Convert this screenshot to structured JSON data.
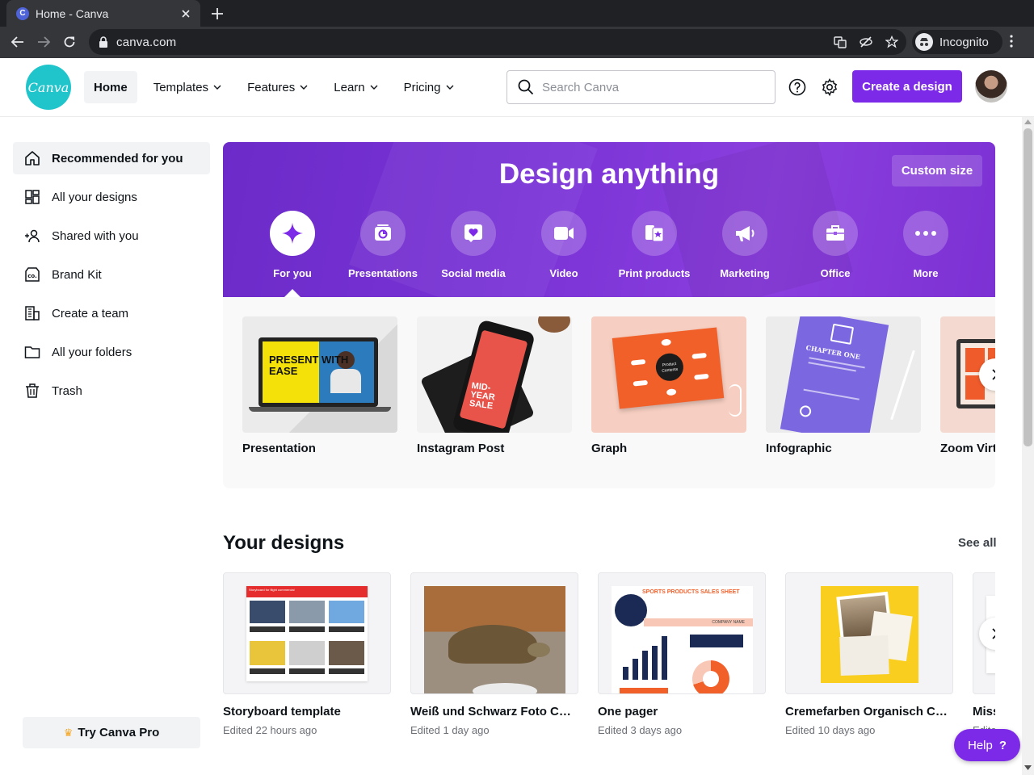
{
  "browser": {
    "tab_title": "Home - Canva",
    "favicon_letter": "C",
    "url": "canva.com",
    "incognito_label": "Incognito"
  },
  "header": {
    "logo_text": "Canva",
    "nav": [
      {
        "label": "Home"
      },
      {
        "label": "Templates"
      },
      {
        "label": "Features"
      },
      {
        "label": "Learn"
      },
      {
        "label": "Pricing"
      }
    ],
    "search_placeholder": "Search Canva",
    "create_label": "Create a design",
    "brand_color": "#7d2ae8"
  },
  "sidebar": {
    "items": [
      {
        "label": "Recommended for you",
        "icon": "home-icon"
      },
      {
        "label": "All your designs",
        "icon": "grid-icon"
      },
      {
        "label": "Shared with you",
        "icon": "people-icon"
      },
      {
        "label": "Brand Kit",
        "icon": "brand-kit-icon"
      },
      {
        "label": "Create a team",
        "icon": "building-icon"
      },
      {
        "label": "All your folders",
        "icon": "folder-icon"
      },
      {
        "label": "Trash",
        "icon": "trash-icon"
      }
    ],
    "pro_label": "Try Canva Pro"
  },
  "hero": {
    "title": "Design anything",
    "custom_size_label": "Custom size",
    "categories": [
      {
        "label": "For you",
        "icon": "sparkle-icon"
      },
      {
        "label": "Presentations",
        "icon": "presentation-icon"
      },
      {
        "label": "Social media",
        "icon": "heart-icon"
      },
      {
        "label": "Video",
        "icon": "video-icon"
      },
      {
        "label": "Print products",
        "icon": "print-icon"
      },
      {
        "label": "Marketing",
        "icon": "megaphone-icon"
      },
      {
        "label": "Office",
        "icon": "briefcase-icon"
      },
      {
        "label": "More",
        "icon": "more-icon"
      }
    ]
  },
  "templates": [
    {
      "name": "Presentation",
      "thumb_text": "PRESENT WITH EASE"
    },
    {
      "name": "Instagram Post",
      "thumb_text": "MID-YEAR SALE"
    },
    {
      "name": "Graph",
      "thumb_text": "Product Contents"
    },
    {
      "name": "Infographic",
      "thumb_text": "CHAPTER ONE"
    },
    {
      "name": "Zoom Virtu"
    }
  ],
  "your_designs": {
    "title": "Your designs",
    "see_all": "See all",
    "items": [
      {
        "name": "Storyboard template",
        "edited": "Edited 22 hours ago",
        "thumb_heading": "Storyboard for flight commercial"
      },
      {
        "name": "Weiß und Schwarz Foto Colla...",
        "edited": "Edited 1 day ago"
      },
      {
        "name": "One pager",
        "edited": "Edited 3 days ago",
        "thumb_heading": "SPORTS PRODUCTS SALES SHEET",
        "thumb_sub": "COMPANY NAME"
      },
      {
        "name": "Cremefarben Organisch Coll...",
        "edited": "Edited 10 days ago"
      },
      {
        "name": "Miss",
        "edited": "Edite"
      }
    ]
  },
  "help_label": "Help",
  "help_mark": "?"
}
